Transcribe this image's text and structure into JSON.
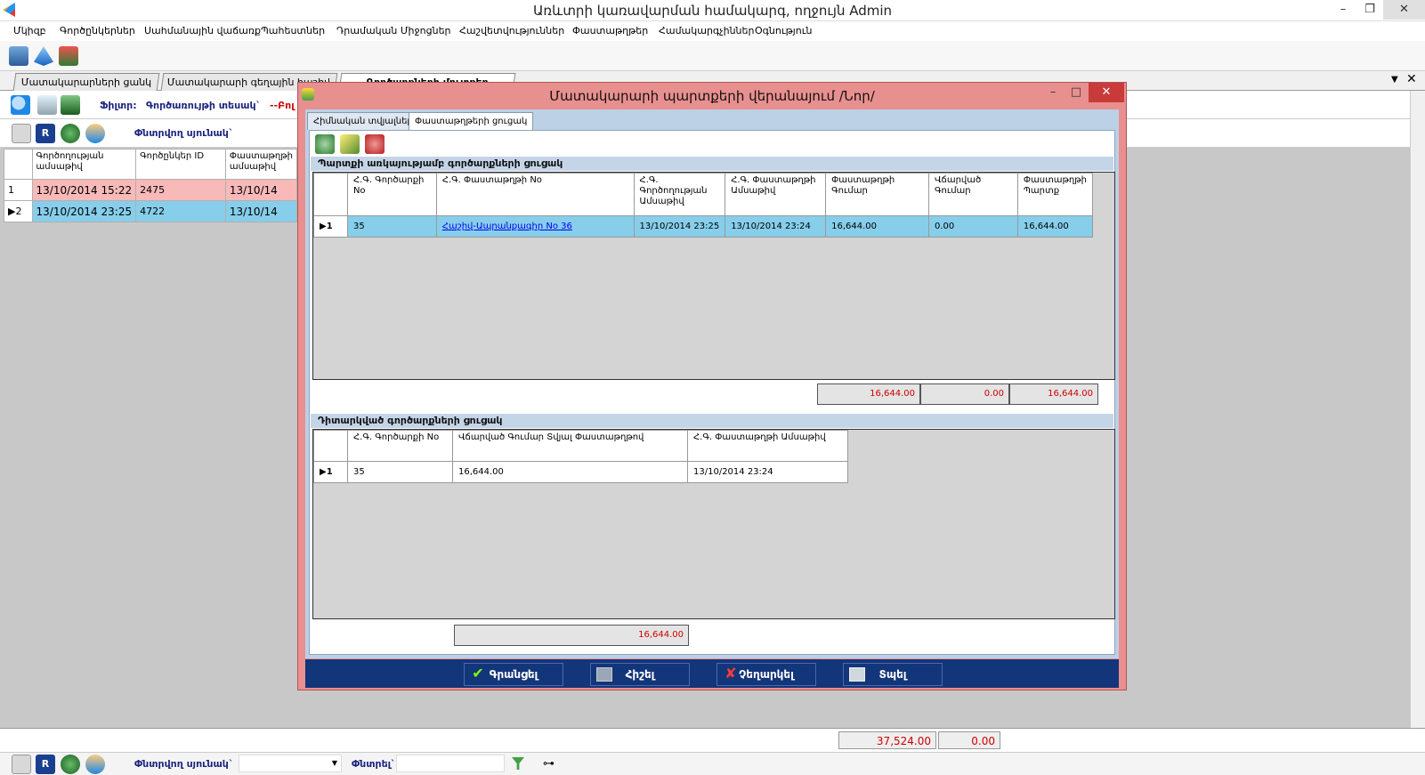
{
  "app": {
    "title": "Առևտրի կառավարման համակարգ, ողջույն Admin",
    "menu": [
      "Մկիզբ",
      "Գործընկերներ",
      "Սահմանային վաճառք",
      "Պահեստներ",
      "Դրամական Միջոցներ",
      "Հաշվետվություններ",
      "Փաստաթղթեր",
      "Համակարգչիններ",
      "Օգնություն"
    ]
  },
  "tabs": [
    {
      "label": "Մատակարարների ցանկ"
    },
    {
      "label": "Մատակարարի գեղային հաշիվ"
    },
    {
      "label": "Գործարքների մուտքեր"
    }
  ],
  "filter": {
    "label": "Ֆիլտր:",
    "field_label": "Գործառույթի տեսակ`",
    "value_fragment": "--Բոլ"
  },
  "toolbar2": {
    "selected_column_label": "Փնտրվող սյունակ`"
  },
  "main_grid": {
    "headers": [
      "",
      "Գործողության ամսաթիվ",
      "Գործընկեր ID",
      "Փաստաթղթի ամսաթիվ"
    ],
    "rows": [
      {
        "index": "1",
        "date": "13/10/2014 15:22",
        "partner_id": "2475",
        "doc_date": "13/10/14"
      },
      {
        "index": "2",
        "date": "13/10/2014 23:25",
        "partner_id": "4722",
        "doc_date": "13/10/14"
      }
    ]
  },
  "bottom": {
    "total1": "37,524.00",
    "total2": "0.00",
    "search_column_label": "Փնտրվող սյունակ`",
    "search_label": "Փնտրել`"
  },
  "dialog": {
    "title": "Մատակարարի պարտքերի վերանայում /Նոր/",
    "tabs": [
      {
        "label": "Հիմնական տվյալներ"
      },
      {
        "label": "Փաստաթղթերի ցուցակ"
      }
    ],
    "section1_title": "Պարտքի առկայությամբ գործարքների ցուցակ",
    "grid1": {
      "headers": [
        "",
        "Հ.Գ. Գործարքի No",
        "Հ.Գ. Փաստաթղթի No",
        "Հ.Գ. Գործողության Ամսաթիվ",
        "Հ.Գ. Փաստաթղթի Ամսաթիվ",
        "Փաստաթղթի Գումար",
        "Վճարված Գումար",
        "Փաստաթղթի Պարտք"
      ],
      "rows": [
        {
          "indicator": "1",
          "deal_no": "35",
          "doc_no": "Հաշիվ-Ապրանքագիր No 36",
          "op_date": "13/10/2014 23:25",
          "doc_date": "13/10/2014 23:24",
          "doc_sum": "16,644.00",
          "paid": "0.00",
          "debt": "16,644.00"
        }
      ],
      "totals": {
        "doc_sum": "16,644.00",
        "paid": "0.00",
        "debt": "16,644.00"
      }
    },
    "section2_title": "Դիտարկված գործարքների ցուցակ",
    "grid2": {
      "headers": [
        "",
        "Հ.Գ. Գործարքի No",
        "Վճարված Գումար Տվյալ Փաստաթղթով",
        "Հ.Գ. Փաստաթղթի Ամսաթիվ"
      ],
      "rows": [
        {
          "indicator": "1",
          "deal_no": "35",
          "paid": "16,644.00",
          "doc_date": "13/10/2014 23:24"
        }
      ],
      "totals": {
        "paid": "16,644.00"
      }
    },
    "footer": {
      "record": "Գրանցել",
      "save": "Հիշել",
      "cancel": "Չեղարկել",
      "print": "Տպել"
    }
  },
  "colors": {
    "accent": "#13357a",
    "dialog_frame": "#e8908f",
    "row_pink": "#f8b9b9",
    "row_blue": "#87ceeb",
    "total_red": "#cc0000"
  }
}
